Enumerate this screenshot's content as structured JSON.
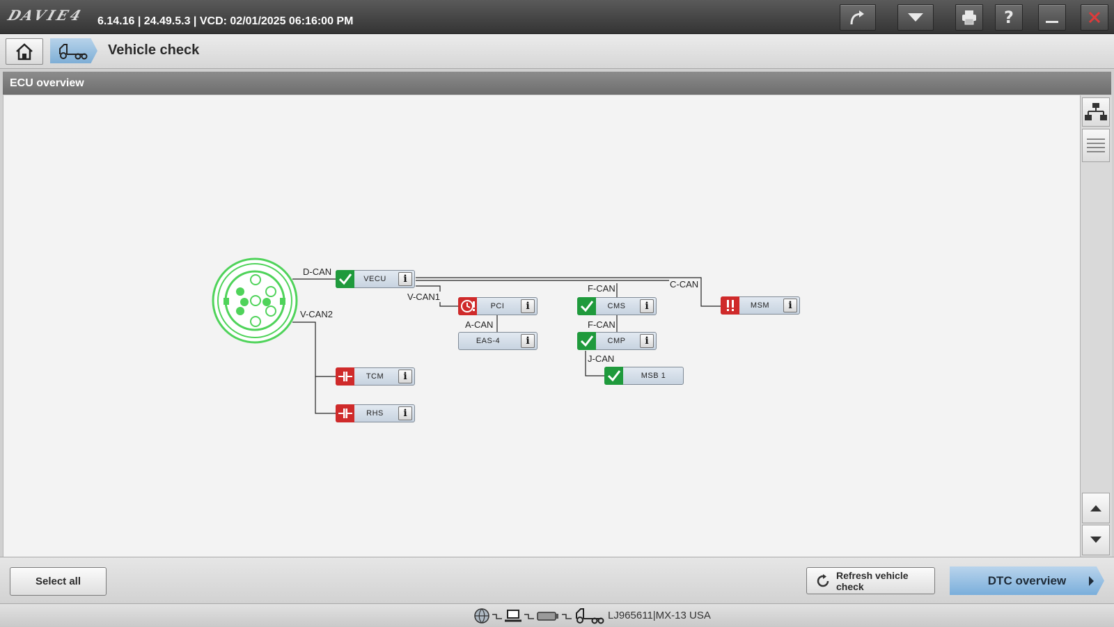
{
  "titlebar": {
    "logo_text": "DAVIE4",
    "version_text": "6.14.16 | 24.49.5.3 | VCD: 02/01/2025 06:16:00 PM"
  },
  "nav": {
    "page_title": "Vehicle check"
  },
  "section": {
    "title": "ECU overview"
  },
  "diagram": {
    "buses": {
      "d_can": "D-CAN",
      "v_can2": "V-CAN2",
      "v_can1": "V-CAN1",
      "a_can": "A-CAN",
      "f_can_1": "F-CAN",
      "f_can_2": "F-CAN",
      "j_can": "J-CAN",
      "c_can": "C-CAN"
    },
    "ecus": {
      "vecu": {
        "name": "VECU",
        "status": "ok"
      },
      "pci": {
        "name": "PCI",
        "status": "fault-clock"
      },
      "eas4": {
        "name": "EAS-4",
        "status": "none"
      },
      "cms": {
        "name": "CMS",
        "status": "ok"
      },
      "cmp": {
        "name": "CMP",
        "status": "ok"
      },
      "msb1": {
        "name": "MSB 1",
        "status": "ok"
      },
      "msm": {
        "name": "MSM",
        "status": "fault-warning"
      },
      "tcm": {
        "name": "TCM",
        "status": "no-communication"
      },
      "rhs": {
        "name": "RHS",
        "status": "no-communication"
      }
    },
    "info_glyph": "i"
  },
  "actions": {
    "select_all": "Select all",
    "refresh": "Refresh vehicle check",
    "dtc_overview": "DTC overview"
  },
  "statusbar": {
    "vehicle_text": "LJ965611|MX-13 USA"
  },
  "colors": {
    "ok": "#1f9a3c",
    "error": "#cf2a2a",
    "connector": "#4fd35a",
    "accent_blue": "#7aaedb"
  }
}
